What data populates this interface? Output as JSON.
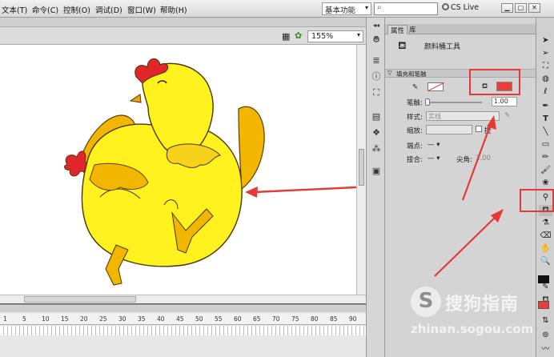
{
  "menu": {
    "items": [
      "文本(T)",
      "命令(C)",
      "控制(O)",
      "调试(D)",
      "窗口(W)",
      "帮助(H)"
    ]
  },
  "workspace": {
    "label": "基本功能"
  },
  "search": {
    "icon": "search-icon"
  },
  "cslive": {
    "label": "CS Live"
  },
  "window_controls": [
    "minimize",
    "restore",
    "close"
  ],
  "stage": {
    "zoom": "155%",
    "accent_line_color": "#e53935"
  },
  "timeline": {
    "ruler": [
      "1",
      "5",
      "10",
      "15",
      "20",
      "25",
      "30",
      "35",
      "40",
      "45",
      "50",
      "55",
      "60",
      "65",
      "70",
      "75",
      "80",
      "85",
      "90"
    ]
  },
  "properties": {
    "tabs": [
      "属性",
      "库"
    ],
    "tool_name": "颜料桶工具",
    "section_title": "填充和笔触",
    "stroke_label": "笔触:",
    "stroke_value": "1.00",
    "style_label": "样式:",
    "style_value": "实线",
    "scale_label": "缩放:",
    "hint_label": "提",
    "cap_label": "端点:",
    "cap_value": "— ▾",
    "join_label": "接合:",
    "join_value": "— ▾",
    "miter_label": "尖角:",
    "miter_value": "3.00",
    "fill_color": "#ee3b3b",
    "highlight_color": "#e53935"
  },
  "tools": {
    "items": [
      "selection-tool",
      "subselection-tool",
      "free-transform-tool",
      "3d-rotation-tool",
      "lasso-tool",
      "pen-tool",
      "text-tool",
      "line-tool",
      "rectangle-tool",
      "pencil-tool",
      "brush-tool",
      "deco-tool",
      "bone-tool",
      "paint-bucket-tool",
      "eyedropper-tool",
      "eraser-tool",
      "hand-tool",
      "zoom-tool"
    ],
    "stroke_color": "#111111",
    "fill_color": "#ee3b3b"
  },
  "watermark": {
    "logo": "S",
    "title": "搜狗指南",
    "url": "zhinan.sogou.com"
  }
}
